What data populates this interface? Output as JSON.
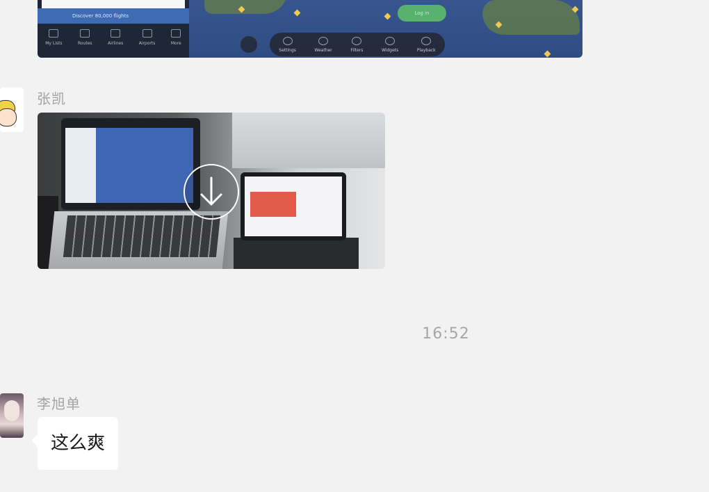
{
  "map_screenshot": {
    "panel_bar_text": "Discover 80,000 flights",
    "panel_tools": [
      "My Lists",
      "Routes",
      "Airlines",
      "Airports",
      "More"
    ],
    "toolbar_items": [
      "Settings",
      "Weather",
      "Filters",
      "Widgets",
      "Playback"
    ],
    "pill_text": "Log in"
  },
  "messages": [
    {
      "sender": "张凯",
      "type": "video",
      "avatar_icon": "cartoon-avatar-icon"
    },
    {
      "type": "timestamp",
      "text": "16:52"
    },
    {
      "sender": "李旭单",
      "type": "text",
      "text": "这么爽",
      "avatar_icon": "portrait-avatar-icon"
    }
  ],
  "colors": {
    "background": "#f2f2f2",
    "bubble": "#ffffff",
    "sender_name": "#a3a3a3",
    "timestamp": "#a6a6a6"
  }
}
